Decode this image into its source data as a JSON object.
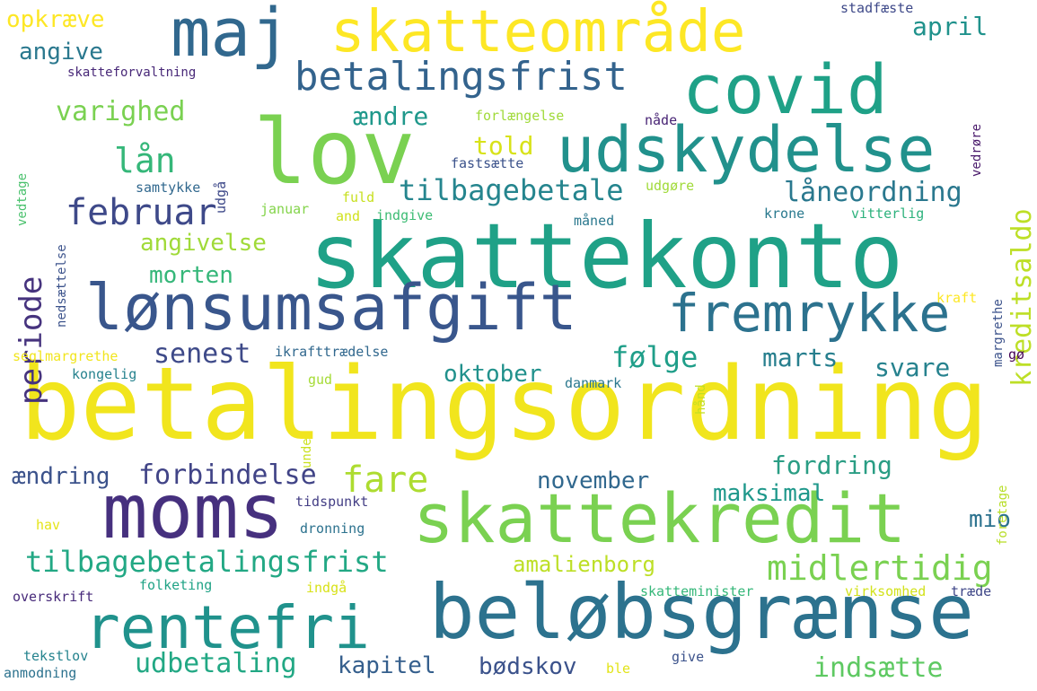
{
  "words": [
    {
      "text": "betalingsordning",
      "color": "#f1e51d"
    },
    {
      "text": "skattekonto",
      "color": "#1fa187"
    },
    {
      "text": "lov",
      "color": "#7ad151"
    },
    {
      "text": "beløbsgrænse",
      "color": "#2c728e"
    },
    {
      "text": "moms",
      "color": "#46307e"
    },
    {
      "text": "skattekredit",
      "color": "#7ad151"
    },
    {
      "text": "covid",
      "color": "#1fa187"
    },
    {
      "text": "udskydelse",
      "color": "#21918c"
    },
    {
      "text": "lønsumsafgift",
      "color": "#39568c"
    },
    {
      "text": "fremrykke",
      "color": "#2c728e"
    },
    {
      "text": "rentefri",
      "color": "#20928c"
    },
    {
      "text": "skatteområde",
      "color": "#fde725"
    },
    {
      "text": "maj",
      "color": "#31688e"
    },
    {
      "text": "betalingsfrist",
      "color": "#33638d"
    },
    {
      "text": "februar",
      "color": "#3e4989"
    },
    {
      "text": "tilbagebetale",
      "color": "#25858e"
    },
    {
      "text": "låneordning",
      "color": "#2a788e"
    },
    {
      "text": "tilbagebetalingsfrist",
      "color": "#22a884"
    },
    {
      "text": "midlertidig",
      "color": "#7ad151"
    },
    {
      "text": "indsætte",
      "color": "#5ec962"
    },
    {
      "text": "udbetaling",
      "color": "#22a884"
    },
    {
      "text": "kapitel",
      "color": "#355f8d"
    },
    {
      "text": "bødskov",
      "color": "#3b528b"
    },
    {
      "text": "amalienborg",
      "color": "#bddf26"
    },
    {
      "text": "november",
      "color": "#31688e"
    },
    {
      "text": "maksimal",
      "color": "#1f988b"
    },
    {
      "text": "fordring",
      "color": "#2a9d84"
    },
    {
      "text": "mio",
      "color": "#2c728e"
    },
    {
      "text": "fare",
      "color": "#addc30"
    },
    {
      "text": "forbindelse",
      "color": "#414487"
    },
    {
      "text": "ændring",
      "color": "#3b528b"
    },
    {
      "text": "oktober",
      "color": "#21918c"
    },
    {
      "text": "følge",
      "color": "#1f9e89"
    },
    {
      "text": "marts",
      "color": "#277f8e"
    },
    {
      "text": "svare",
      "color": "#26828e"
    },
    {
      "text": "senest",
      "color": "#3e4a89"
    },
    {
      "text": "morten",
      "color": "#35b779"
    },
    {
      "text": "angivelse",
      "color": "#a0da39"
    },
    {
      "text": "periode",
      "color": "#46337e"
    },
    {
      "text": "lån",
      "color": "#35b779"
    },
    {
      "text": "varighed",
      "color": "#7ad151"
    },
    {
      "text": "angive",
      "color": "#2a788e"
    },
    {
      "text": "opkræve",
      "color": "#fde725"
    },
    {
      "text": "ændre",
      "color": "#1f988b"
    },
    {
      "text": "told",
      "color": "#d8e219"
    },
    {
      "text": "april",
      "color": "#20928c"
    },
    {
      "text": "kreditsaldo",
      "color": "#bddf26"
    },
    {
      "text": "skatteforvaltning",
      "color": "#482878"
    },
    {
      "text": "forlængelse",
      "color": "#a0da39"
    },
    {
      "text": "nåde",
      "color": "#482475"
    },
    {
      "text": "fastsætte",
      "color": "#3b528b"
    },
    {
      "text": "samtykke",
      "color": "#31688e"
    },
    {
      "text": "udgå",
      "color": "#3e4989"
    },
    {
      "text": "fuld",
      "color": "#c8e020"
    },
    {
      "text": "udgøre",
      "color": "#a0da39"
    },
    {
      "text": "januar",
      "color": "#84d44b"
    },
    {
      "text": "and",
      "color": "#d0e11c"
    },
    {
      "text": "indgive",
      "color": "#3dbc74"
    },
    {
      "text": "måned",
      "color": "#2a788e"
    },
    {
      "text": "krone",
      "color": "#29798e"
    },
    {
      "text": "vitterlig",
      "color": "#2db27d"
    },
    {
      "text": "margrethe",
      "color": "#3b528b"
    },
    {
      "text": "kraft",
      "color": "#fde725"
    },
    {
      "text": "gø",
      "color": "#440154"
    },
    {
      "text": "seglmargrethe",
      "color": "#f1e51d"
    },
    {
      "text": "ikrafttrædelse",
      "color": "#31688e"
    },
    {
      "text": "kongelig",
      "color": "#26828e"
    },
    {
      "text": "gud",
      "color": "#a5db36"
    },
    {
      "text": "danmark",
      "color": "#2a788e"
    },
    {
      "text": "unde",
      "color": "#cae11f"
    },
    {
      "text": "hånd",
      "color": "#c2df23"
    },
    {
      "text": "foretage",
      "color": "#b8de29"
    },
    {
      "text": "tidspunkt",
      "color": "#433e85"
    },
    {
      "text": "hav",
      "color": "#e5e419"
    },
    {
      "text": "dronning",
      "color": "#2c728e"
    },
    {
      "text": "folketing",
      "color": "#20a386"
    },
    {
      "text": "indgå",
      "color": "#d8e219"
    },
    {
      "text": "overskrift",
      "color": "#472a7a"
    },
    {
      "text": "skatteminister",
      "color": "#35b779"
    },
    {
      "text": "virksomhed",
      "color": "#d2e21b"
    },
    {
      "text": "træde",
      "color": "#3f4788"
    },
    {
      "text": "tekstlov",
      "color": "#25838e"
    },
    {
      "text": "anmodning",
      "color": "#2c728e"
    },
    {
      "text": "ble",
      "color": "#e2e418"
    },
    {
      "text": "give",
      "color": "#3b528b"
    },
    {
      "text": "stadfæste",
      "color": "#3e4989"
    },
    {
      "text": "vedrøre",
      "color": "#48186a"
    },
    {
      "text": "vedtage",
      "color": "#4ac16d"
    },
    {
      "text": "nedsættelse",
      "color": "#3b528b"
    }
  ]
}
